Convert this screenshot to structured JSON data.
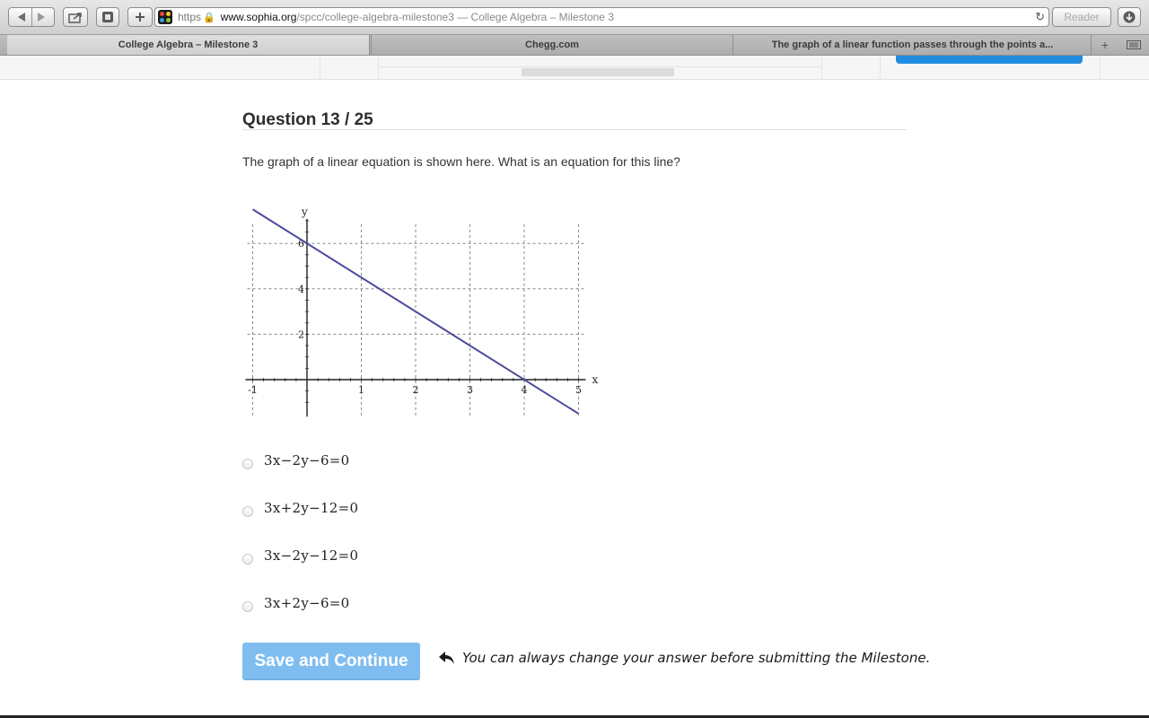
{
  "browser": {
    "url": {
      "scheme": "https",
      "host": "www.sophia.org",
      "path": "/spcc/college-algebra-milestone3",
      "title_suffix": " — College Algebra – Milestone 3"
    },
    "reader_label": "Reader",
    "tabs": [
      {
        "label": "College Algebra – Milestone 3",
        "active": true
      },
      {
        "label": "Chegg.com",
        "active": false
      },
      {
        "label": "The graph of a linear function passes through the points a...",
        "active": false
      }
    ]
  },
  "question": {
    "title": "Question 13 / 25",
    "prompt": "The graph of a linear equation is shown here. What is an equation for this line?"
  },
  "chart_data": {
    "type": "line",
    "xlabel": "x",
    "ylabel": "y",
    "xlim": [
      -1,
      5
    ],
    "ylim": [
      -1,
      7
    ],
    "x_ticks": [
      "-1",
      "1",
      "2",
      "3",
      "4",
      "5"
    ],
    "y_ticks": [
      "2",
      "4",
      "6"
    ],
    "grid": true,
    "series": [
      {
        "x": [
          -1,
          5
        ],
        "y": [
          7.5,
          -1.5
        ],
        "color": "#4b4a9e"
      }
    ]
  },
  "options": [
    {
      "label": "3x−2y−6=0"
    },
    {
      "label": "3x+2y−12=0"
    },
    {
      "label": "3x−2y−12=0"
    },
    {
      "label": "3x+2y−6=0"
    }
  ],
  "actions": {
    "save_label": "Save and Continue",
    "hint": "You can always change your answer before submitting the Milestone.",
    "primary_color": "#7fbdf0"
  }
}
